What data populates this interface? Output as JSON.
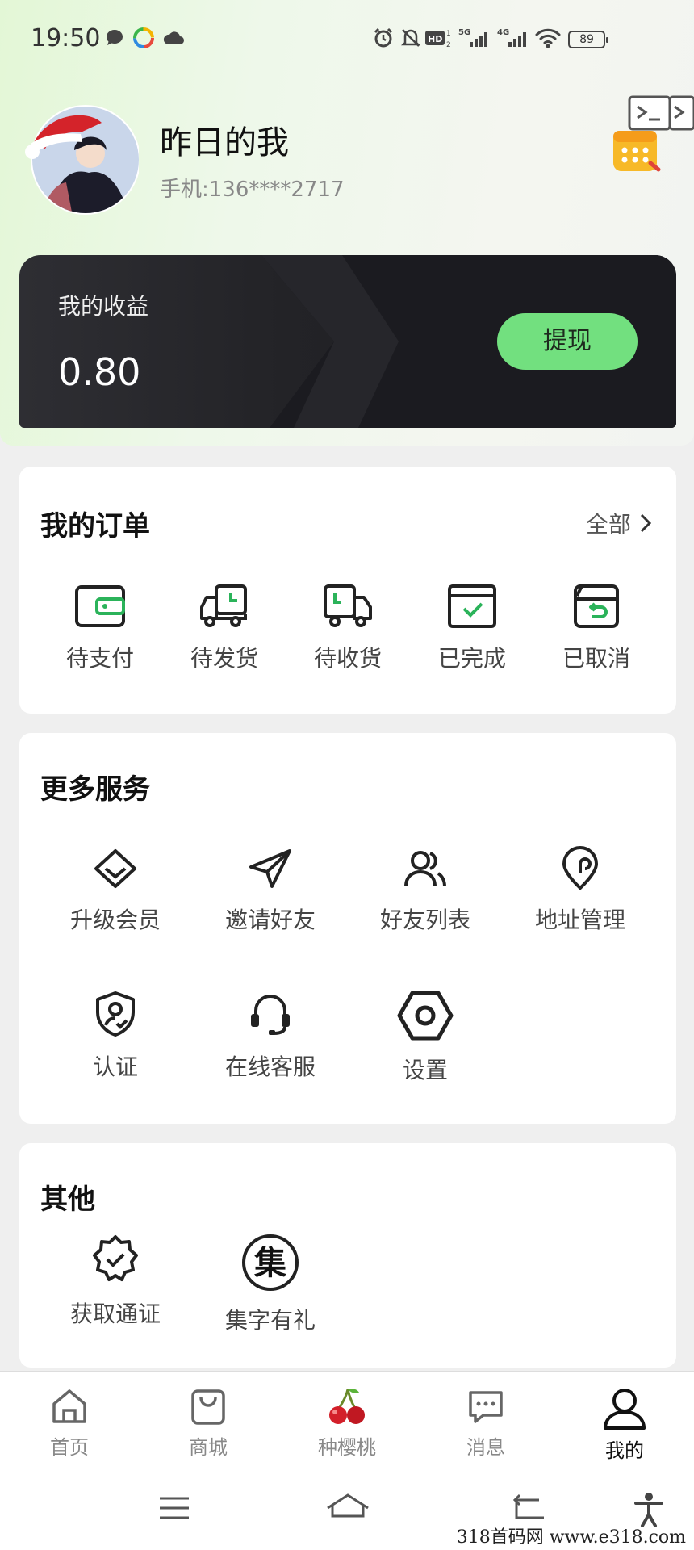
{
  "status_bar": {
    "time": "19:50",
    "battery": "89"
  },
  "profile": {
    "name": "昨日的我",
    "phone": "手机:136****2717"
  },
  "earnings": {
    "label": "我的收益",
    "value": "0.80",
    "withdraw_label": "提现"
  },
  "orders": {
    "title": "我的订单",
    "view_all": "全部",
    "items": [
      {
        "label": "待支付",
        "icon": "wallet-icon"
      },
      {
        "label": "待发货",
        "icon": "truck-clock-icon"
      },
      {
        "label": "待收货",
        "icon": "truck-icon"
      },
      {
        "label": "已完成",
        "icon": "box-check-icon"
      },
      {
        "label": "已取消",
        "icon": "box-return-icon"
      }
    ]
  },
  "services": {
    "title": "更多服务",
    "items": [
      {
        "label": "升级会员",
        "icon": "diamond-icon"
      },
      {
        "label": "邀请好友",
        "icon": "paper-plane-icon"
      },
      {
        "label": "好友列表",
        "icon": "users-icon"
      },
      {
        "label": "地址管理",
        "icon": "location-pin-icon"
      },
      {
        "label": "认证",
        "icon": "shield-user-icon"
      },
      {
        "label": "在线客服",
        "icon": "headset-icon"
      },
      {
        "label": "设置",
        "icon": "hex-settings-icon"
      }
    ]
  },
  "others": {
    "title": "其他",
    "items": [
      {
        "label": "获取通证",
        "icon": "badge-check-icon"
      },
      {
        "label": "集字有礼",
        "icon": "collect-char-icon",
        "glyph": "集"
      }
    ]
  },
  "tabs": [
    {
      "label": "首页",
      "icon": "home-icon"
    },
    {
      "label": "商城",
      "icon": "shopping-bag-icon"
    },
    {
      "label": "种樱桃",
      "icon": "cherry-icon"
    },
    {
      "label": "消息",
      "icon": "message-icon"
    },
    {
      "label": "我的",
      "icon": "user-icon",
      "active": true
    }
  ],
  "watermark": "318首码网  www.e318.com",
  "colors": {
    "accent": "#72e07f",
    "card_dark": "#232327",
    "icon_green": "#2bb35a"
  }
}
